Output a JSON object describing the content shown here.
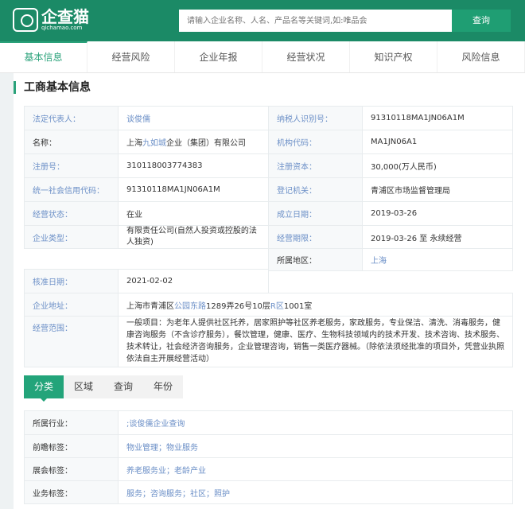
{
  "header": {
    "logo_name": "企查猫",
    "logo_url": "qichamao.com",
    "search_placeholder": "请输入企业名称、人名、产品名等关键词,如:唯品会",
    "search_button": "查询"
  },
  "nav": [
    "基本信息",
    "经营风险",
    "企业年报",
    "经营状况",
    "知识产权",
    "风险信息"
  ],
  "section_title": "工商基本信息",
  "info": {
    "legal_rep_label": "法定代表人：",
    "legal_rep": "谈俊儒",
    "tax_id_label": "纳税人识别号：",
    "tax_id": "91310118MA1JN06A1M",
    "name_label": "名称：",
    "name_pre": "上海",
    "name_link": "九如城",
    "name_post": "企业（集团）有限公司",
    "org_code_label": "机构代码：",
    "org_code": "MA1JN06A1",
    "reg_no_label": "注册号：",
    "reg_no": "310118003774383",
    "capital_label": "注册资本：",
    "capital": "30,000(万人民币)",
    "credit_code_label": "统一社会信用代码：",
    "credit_code": "91310118MA1JN06A1M",
    "authority_label": "登记机关：",
    "authority": "青浦区市场监督管理局",
    "status_label": "经营状态：",
    "status": "在业",
    "founded_label": "成立日期：",
    "founded": "2019-03-26",
    "type_label": "企业类型：",
    "type": "有限责任公司(自然人投资或控股的法人独资)",
    "term_label": "经营期限：",
    "term": "2019-03-26 至 永续经营",
    "region_label": "所属地区：",
    "region": "上海",
    "approved_label": "核准日期：",
    "approved": "2021-02-02",
    "address_label": "企业地址：",
    "addr_1": "上海市青浦区",
    "addr_link1": "公园东路",
    "addr_2": "1289弄26号10层",
    "addr_link2": "R区",
    "addr_3": "1001室",
    "scope_label": "经营范围：",
    "scope": "一般项目：为老年人提供社区托养，居家照护等社区养老服务，家政服务，专业保洁、清洗、消毒服务，健康咨询服务（不含诊疗服务），餐饮管理，健康、医疗、生物科技领域内的技术开发、技术咨询、技术服务、技术转让，社会经济咨询服务，企业管理咨询，销售一类医疗器械。（除依法须经批准的项目外，凭营业执照依法自主开展经营活动）"
  },
  "tabs": [
    "分类",
    "区域",
    "查询",
    "年份"
  ],
  "tags": [
    {
      "label": "所属行业：",
      "value": ";谈俊儒企业查询"
    },
    {
      "label": "前瞻标签：",
      "value": "物业管理；物业服务"
    },
    {
      "label": "展会标签：",
      "value": "养老服务业；老龄产业"
    },
    {
      "label": "业务标签：",
      "value": "服务；咨询服务；社区；照护"
    }
  ]
}
